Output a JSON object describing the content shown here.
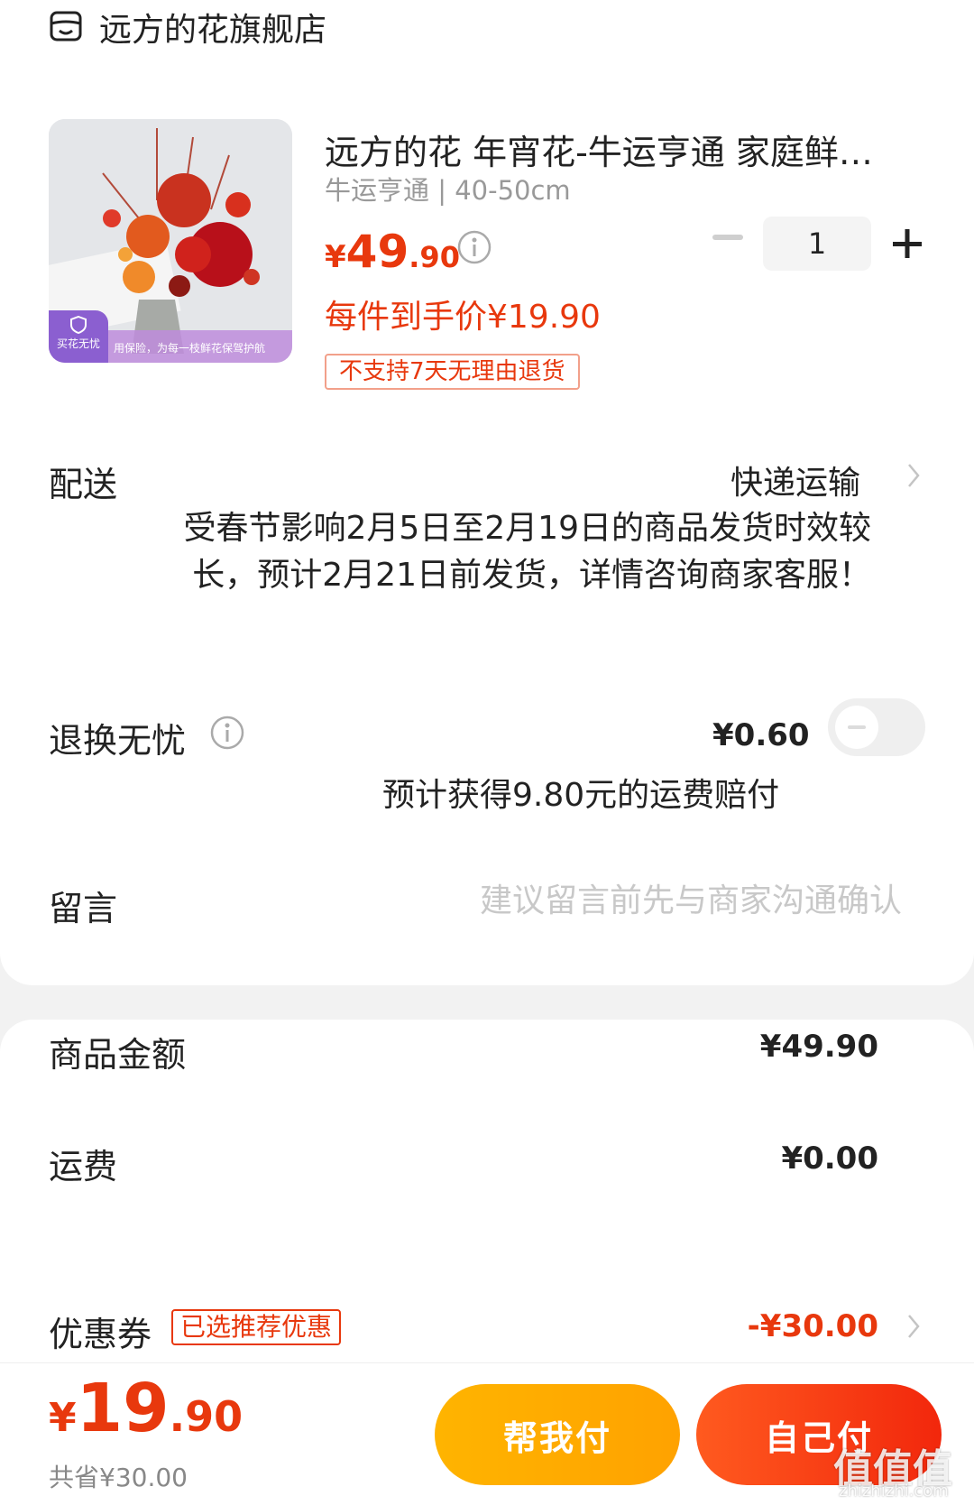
{
  "store": {
    "name": "远方的花旗舰店",
    "icon": "store-icon"
  },
  "product": {
    "title": "远方的花 年宵花-牛运亨通 家庭鲜花...",
    "spec": "牛运亨通 | 40-50cm",
    "price_yen": "¥",
    "price_int": "49",
    "price_dec": ".90",
    "per_item_price": "每件到手价¥19.90",
    "no_return_tag": "不支持7天无理由退货",
    "quantity": "1",
    "thumb_badge": "买花无忧",
    "thumb_band_text": "用保险，为每一枝鲜花保驾护航"
  },
  "delivery": {
    "label": "配送",
    "value": "快递运输",
    "notice": "受春节影响2月5日至2月19日的商品发货时效较长，预计2月21日前发货，详情咨询商家客服！"
  },
  "return_service": {
    "label": "退换无忧",
    "price": "¥0.60",
    "note": "预计获得9.80元的运费赔付",
    "enabled": false
  },
  "message": {
    "label": "留言",
    "placeholder": "建议留言前先与商家沟通确认"
  },
  "summary": {
    "goods_label": "商品金额",
    "goods_value": "¥49.90",
    "shipping_label": "运费",
    "shipping_value": "¥0.00",
    "coupon_label": "优惠券",
    "coupon_tag": "已选推荐优惠",
    "coupon_value": "-¥30.00"
  },
  "bottom": {
    "total_yen": "¥",
    "total_int": "19",
    "total_dec": ".90",
    "saved": "共省¥30.00",
    "help_pay": "帮我付",
    "self_pay": "自己付"
  },
  "watermark": {
    "text": "值值值",
    "sub": "zhizhizhi.com"
  },
  "colors": {
    "accent_red": "#e8380d",
    "help_button": "#ffa200",
    "self_button": "#f2270c"
  }
}
